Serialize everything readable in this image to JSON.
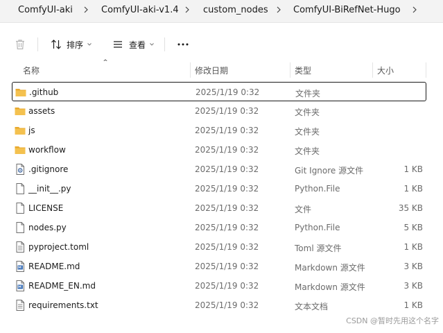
{
  "breadcrumb": [
    "ComfyUI-aki",
    "ComfyUI-aki-v1.4",
    "custom_nodes",
    "ComfyUI-BiRefNet-Hugo"
  ],
  "toolbar": {
    "sort_label": "排序",
    "view_label": "查看",
    "more_label": "···"
  },
  "columns": {
    "name": "名称",
    "date": "修改日期",
    "type": "类型",
    "size": "大小"
  },
  "files": [
    {
      "icon": "folder-icon",
      "name": ".github",
      "date": "2025/1/19 0:32",
      "type": "文件夹",
      "size": ""
    },
    {
      "icon": "folder-icon",
      "name": "assets",
      "date": "2025/1/19 0:32",
      "type": "文件夹",
      "size": ""
    },
    {
      "icon": "folder-icon",
      "name": "js",
      "date": "2025/1/19 0:32",
      "type": "文件夹",
      "size": ""
    },
    {
      "icon": "folder-icon",
      "name": "workflow",
      "date": "2025/1/19 0:32",
      "type": "文件夹",
      "size": ""
    },
    {
      "icon": "gear-file-icon",
      "name": ".gitignore",
      "date": "2025/1/19 0:32",
      "type": "Git Ignore 源文件",
      "size": "1 KB"
    },
    {
      "icon": "file-icon",
      "name": "__init__.py",
      "date": "2025/1/19 0:32",
      "type": "Python.File",
      "size": "1 KB"
    },
    {
      "icon": "file-icon",
      "name": "LICENSE",
      "date": "2025/1/19 0:32",
      "type": "文件",
      "size": "35 KB"
    },
    {
      "icon": "file-icon",
      "name": "nodes.py",
      "date": "2025/1/19 0:32",
      "type": "Python.File",
      "size": "5 KB"
    },
    {
      "icon": "text-file-icon",
      "name": "pyproject.toml",
      "date": "2025/1/19 0:32",
      "type": "Toml 源文件",
      "size": "1 KB"
    },
    {
      "icon": "markdown-file-icon",
      "name": "README.md",
      "date": "2025/1/19 0:32",
      "type": "Markdown 源文件",
      "size": "3 KB"
    },
    {
      "icon": "markdown-file-icon",
      "name": "README_EN.md",
      "date": "2025/1/19 0:32",
      "type": "Markdown 源文件",
      "size": "3 KB"
    },
    {
      "icon": "text-file-icon",
      "name": "requirements.txt",
      "date": "2025/1/19 0:32",
      "type": "文本文档",
      "size": "1 KB"
    }
  ],
  "watermark": "CSDN @暂时先用这个名字",
  "colors": {
    "folder": "#f4c14f",
    "folder_tab": "#e8a92e",
    "selection_border": "#1a1a1a"
  }
}
